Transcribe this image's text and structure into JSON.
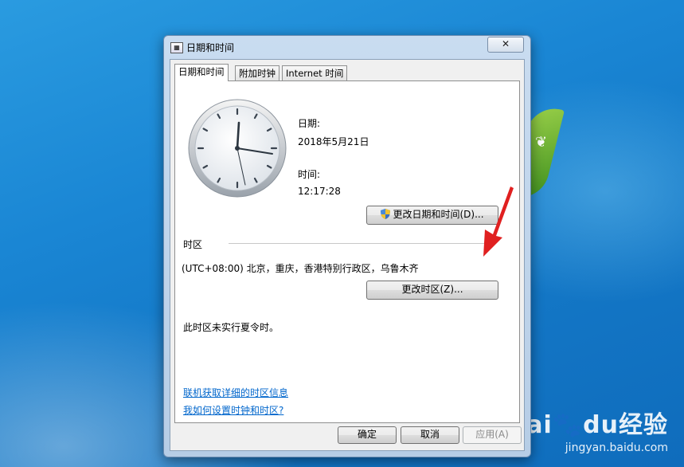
{
  "window": {
    "title": "日期和时间",
    "close_label": "✕",
    "tabs": [
      {
        "label": "日期和时间",
        "active": true
      },
      {
        "label": "附加时钟",
        "active": false
      },
      {
        "label": "Internet 时间",
        "active": false
      }
    ]
  },
  "datetime": {
    "date_label": "日期:",
    "date_value": "2018年5月21日",
    "time_label": "时间:",
    "time_value": "12:17:28",
    "change_button": "更改日期和时间(D)..."
  },
  "timezone": {
    "section_label": "时区",
    "value": "(UTC+08:00) 北京，重庆，香港特别行政区，乌鲁木齐",
    "change_button": "更改时区(Z)...",
    "dst_note": "此时区未实行夏令时。"
  },
  "links": {
    "online_info": "联机获取详细的时区信息",
    "how_to": "我如何设置时钟和时区?"
  },
  "footer": {
    "ok": "确定",
    "cancel": "取消",
    "apply": "应用(A)"
  },
  "watermark": {
    "logo": "Bai🐾du经验",
    "url": "jingyan.baidu.com"
  },
  "colors": {
    "desktop": "#1a86d4",
    "link": "#0066cc",
    "annotation_arrow": "#e02020"
  }
}
